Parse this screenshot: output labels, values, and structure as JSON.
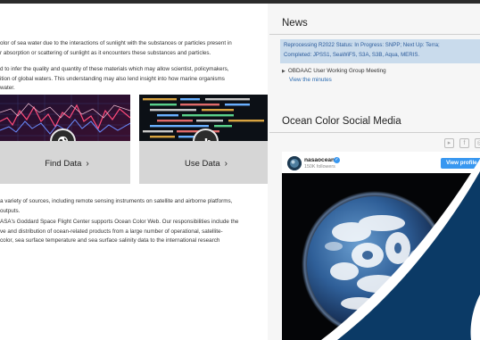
{
  "intro": {
    "line1": "olor of sea water due to the interactions of sunlight with the substances or particles present in",
    "line2": "r absorption or scattering of sunlight as it encounters these substances and particles.",
    "line3": "d to infer the quality and quantity of these materials which may allow scientist, policymakers,",
    "line4": "ition of global waters. This understanding may also lend insight into how marine organisms",
    "line5": "water."
  },
  "cards": [
    {
      "label": "Find Data",
      "icon": "globe-icon"
    },
    {
      "label": "Use Data",
      "icon": "bar-chart-icon"
    }
  ],
  "about": {
    "line1": "a variety of sources, including remote sensing instruments on satellite and airborne platforms,",
    "line2": "outputs.",
    "line3": "ASA's Goddard Space Flight Center supports Ocean Color Web. Our responsibilities include the",
    "line4": "ve and distribution of ocean-related products from a large number of operational, satellite-",
    "line5": "color, sea surface temperature and sea surface salinity data to the international research"
  },
  "news": {
    "title": "News",
    "alert_line1": "Reprocessing R2022 Status: In Progress: SNPP; Next Up: Terra;",
    "alert_line2": "Completed: JPSS1, SeaWiFS, S3A, S3B, Aqua, MERIS.",
    "item": "OBDAAC User Working Group Meeting",
    "link": "View the minutes"
  },
  "social": {
    "title": "Ocean Color Social Media",
    "icons": [
      "youtube-icon",
      "facebook-icon",
      "instagram-icon"
    ],
    "instagram": {
      "username": "nasaocean",
      "followers": "150K followers",
      "button": "View profile"
    }
  },
  "colors": {
    "accent_link": "#2a6ab0",
    "alert_bg": "#c9dbec",
    "instagram_blue": "#3897f0",
    "brand_navy": "#0b3a66"
  }
}
